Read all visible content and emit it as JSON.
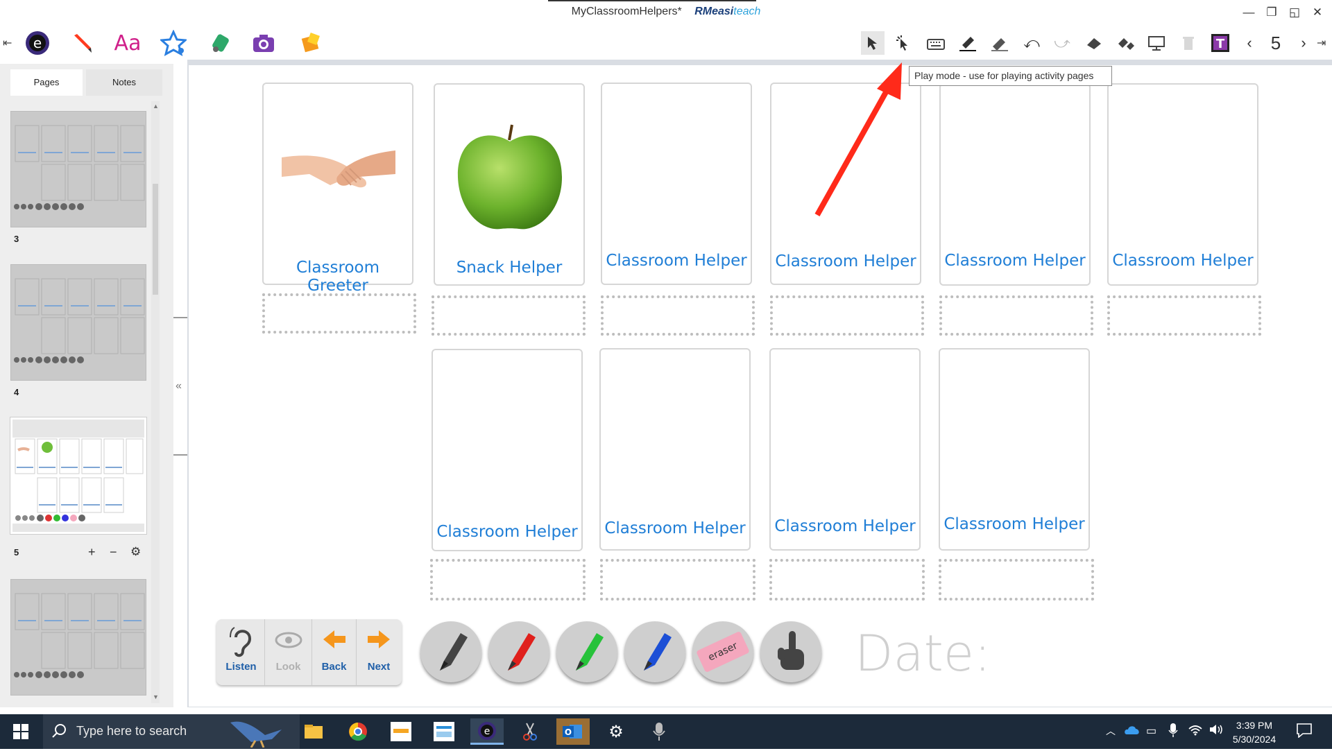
{
  "window": {
    "title": "MyClassroomHelpers*",
    "brand_a": "RM",
    "brand_b": "easi",
    "brand_c": "teach"
  },
  "page_nav": {
    "current_page": "5"
  },
  "tooltip": {
    "text": "Play mode - use for playing activity pages"
  },
  "left_panel": {
    "tabs": [
      "Pages",
      "Notes"
    ],
    "thumbnails": [
      {
        "number": "3"
      },
      {
        "number": "4"
      },
      {
        "number": "5"
      },
      {
        "number": ""
      }
    ],
    "page_controls": {
      "add": "+",
      "remove": "−",
      "settings": "⚙"
    }
  },
  "cards": {
    "row1": [
      {
        "label": "Classroom Greeter",
        "image": "handshake-image"
      },
      {
        "label": "Snack Helper",
        "image": "apple-image"
      },
      {
        "label": "Classroom Helper"
      },
      {
        "label": "Classroom Helper"
      },
      {
        "label": "Classroom Helper"
      },
      {
        "label": "Classroom Helper"
      }
    ],
    "row2": [
      {
        "label": "Classroom Helper"
      },
      {
        "label": "Classroom Helper"
      },
      {
        "label": "Classroom Helper"
      },
      {
        "label": "Classroom Helper"
      }
    ]
  },
  "bottom_tools": {
    "nav_buttons": [
      {
        "label": "Listen",
        "icon": "ear-icon",
        "enabled": true
      },
      {
        "label": "Look",
        "icon": "eye-icon",
        "enabled": false
      },
      {
        "label": "Back",
        "icon": "arrow-left-icon",
        "enabled": true
      },
      {
        "label": "Next",
        "icon": "arrow-right-icon",
        "enabled": true
      }
    ],
    "pens": [
      {
        "name": "black-marker",
        "color": "#444444"
      },
      {
        "name": "red-marker",
        "color": "#e0201c"
      },
      {
        "name": "green-marker",
        "color": "#27c23a"
      },
      {
        "name": "blue-marker",
        "color": "#1c4fd6"
      },
      {
        "name": "eraser",
        "label": "eraser",
        "color": "#f4a7bd"
      },
      {
        "name": "pointer-hand",
        "color": "#444444"
      }
    ],
    "date_label": "Date:"
  },
  "taskbar": {
    "search_placeholder": "Type here to search",
    "time": "3:39 PM",
    "date": "5/30/2024"
  },
  "colors": {
    "label_blue": "#1f7ed6",
    "arrow_red": "#ff2a1a"
  }
}
